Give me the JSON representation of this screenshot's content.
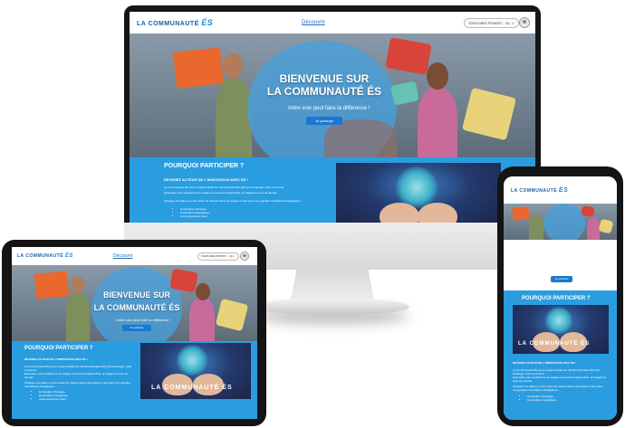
{
  "site": {
    "logo_text": "LA COMMUNAUTÉ",
    "logo_accent": "ÉS",
    "nav_link": "Découvrir",
    "points_label": "TOUS MES POINTS",
    "points_value": ": 10",
    "hero_title_line1": "BIENVENUE SUR",
    "hero_title_line2": "LA COMMUNAUTÉ ÉS",
    "hero_subtitle": "Votre voix peut faire la différence !",
    "hero_button": "Je participe",
    "section_title": "POURQUOI PARTICIPER ?",
    "section_subtitle": "DEVENEZ ACTEUR DE L'INNOVATION AVEC ÉS !",
    "section_paragraph1": "La Communauté ÉS est un espace dédié aux clients particuliers ÉS pour échanger, créer et innover.",
    "section_paragraph2": "Ensemble nous améliorons les usages et services d'aujourd'hui, et imaginons ceux de demain.",
    "section_paragraph3": "Partagez vos idées et votre vision de l'avenir autour de projets en lien avec nos grandes orientations stratégiques :",
    "bullets": [
      "la transition d'énergie,",
      "la transition énergétique,",
      "votre expérience client."
    ],
    "hands_brand": "LA COMMUNAUTÉ ÉS"
  },
  "colors": {
    "brand_blue": "#2a9de0",
    "logo_blue": "#1a5fa8",
    "button_blue": "#1a78d0",
    "accent_orange": "#e8682e"
  },
  "icons": [
    "user-avatar-icon",
    "star-points-icon",
    "lightbulb-illustration"
  ]
}
